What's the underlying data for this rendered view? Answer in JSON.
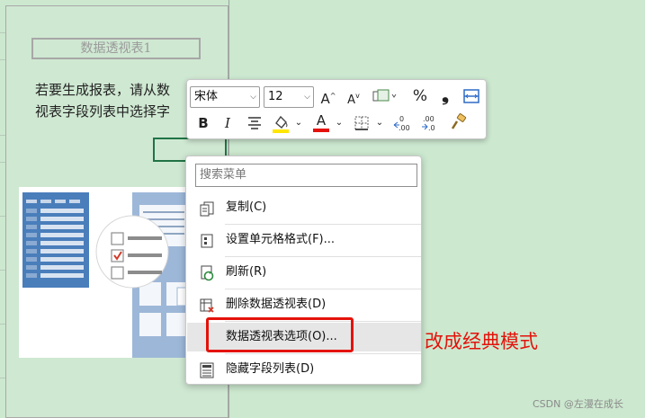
{
  "pivot": {
    "title": "数据透视表1",
    "hint": "若要生成报表，请从数\n视表字段列表中选择字"
  },
  "toolbar": {
    "font_name": "宋体",
    "font_size": "12",
    "grow_font": "A",
    "shrink_font": "A",
    "percent": "%",
    "comma": "❟",
    "bold": "B",
    "italic": "I",
    "font_color_letter": "A",
    "font_color": "#e4120b",
    "fill_color": "#ffe600"
  },
  "menu": {
    "search_placeholder": "搜索菜单",
    "items": [
      {
        "label": "复制(C)",
        "icon": "copy-icon"
      },
      {
        "label": "设置单元格格式(F)...",
        "icon": "format-cells-icon"
      },
      {
        "label": "刷新(R)",
        "icon": "refresh-icon"
      },
      {
        "label": "删除数据透视表(D)",
        "icon": "delete-pivot-icon"
      },
      {
        "label": "数据透视表选项(O)...",
        "icon": ""
      },
      {
        "label": "隐藏字段列表(D)",
        "icon": "field-list-icon"
      }
    ]
  },
  "annotation": {
    "text": "改成经典模式",
    "color": "#e4120b"
  },
  "watermark": "CSDN @左漫在成长"
}
